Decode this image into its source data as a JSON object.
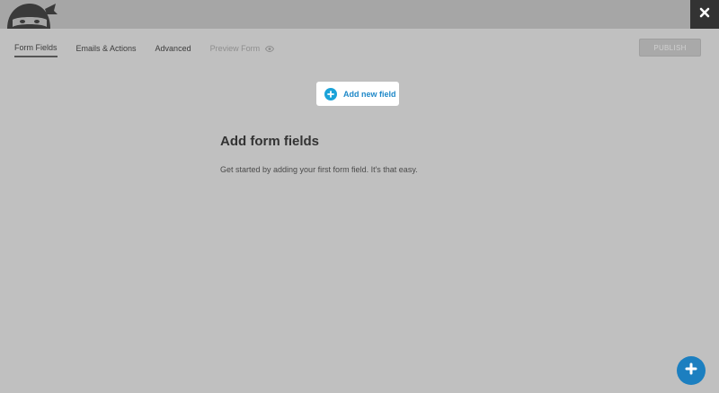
{
  "header": {
    "logo_icon": "ninja-forms-logo-icon",
    "close_icon": "close-icon"
  },
  "tabs": [
    {
      "label": "Form Fields",
      "state": "active"
    },
    {
      "label": "Emails & Actions",
      "state": "normal"
    },
    {
      "label": "Advanced",
      "state": "normal"
    },
    {
      "label": "Preview Form",
      "state": "disabled",
      "icon": "eye-icon"
    }
  ],
  "toolbar": {
    "publish_label": "PUBLISH"
  },
  "main": {
    "add_field_label": "Add new field",
    "add_field_icon": "plus-circle-icon",
    "empty_title": "Add form fields",
    "empty_description": "Get started by adding your first form field. It's that easy."
  },
  "fab": {
    "icon": "plus-icon"
  },
  "colors": {
    "overlay_bg": "#c0c0c0",
    "topbar": "#a6a6a6",
    "accent_blue": "#1ba3d9",
    "fab_blue": "#1c7fc0",
    "close_bg": "#333333"
  }
}
